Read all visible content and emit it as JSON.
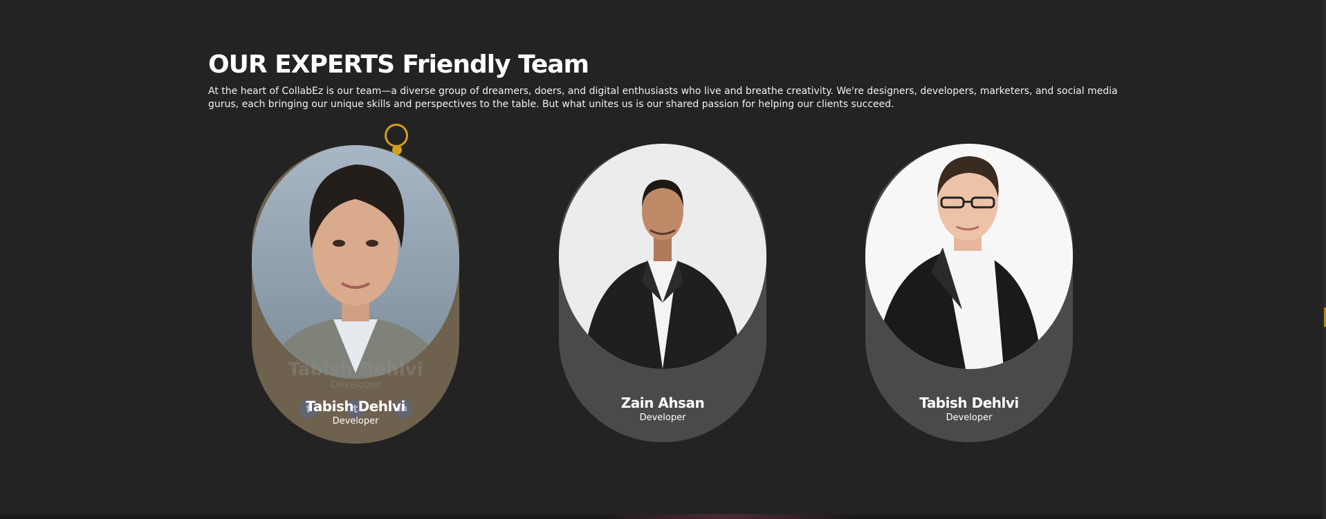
{
  "section": {
    "title": "OUR EXPERTS Friendly Team",
    "description": "At the heart of CollabEz is our team—a diverse group of dreamers, doers, and digital enthusiasts who live and breathe creativity. We're designers, developers, marketers, and social media gurus, each bringing our unique skills and perspectives to the table. But what unites us is our shared passion for helping our clients succeed."
  },
  "team": [
    {
      "name": "Tabish Dehlvi",
      "role": "Developer",
      "ghost_name": "Tabish Dehlvi",
      "ghost_role": "Developer",
      "socials": [
        {
          "icon": "facebook-icon",
          "glyph": "f"
        },
        {
          "icon": "twitter-icon",
          "glyph": "t"
        },
        {
          "icon": "linkedin-icon",
          "glyph": "in"
        }
      ]
    },
    {
      "name": "Zain Ahsan",
      "role": "Developer"
    },
    {
      "name": "Tabish Dehlvi",
      "role": "Developer"
    }
  ],
  "colors": {
    "background": "#232323",
    "accent": "#d4a017",
    "card": "#4a4a4a",
    "card_active": "#6e624e"
  }
}
